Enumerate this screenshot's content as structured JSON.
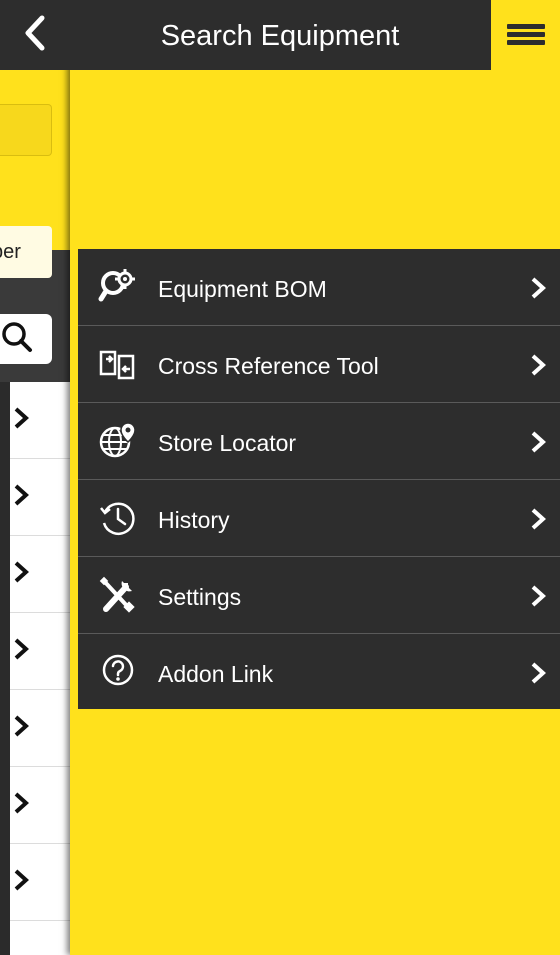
{
  "header": {
    "title": "Search Equipment",
    "back_icon": "chevron-left-icon",
    "menu_icon": "hamburger-menu-icon"
  },
  "background_page": {
    "input_partial_text": "ber",
    "search_icon": "magnifier-icon",
    "list_row_count": 7
  },
  "menu": {
    "items": [
      {
        "label": "Equipment BOM",
        "icon": "gear-search-icon"
      },
      {
        "label": "Cross Reference Tool",
        "icon": "cross-reference-icon"
      },
      {
        "label": "Store Locator",
        "icon": "globe-pin-icon"
      },
      {
        "label": "History",
        "icon": "history-clock-icon"
      },
      {
        "label": "Settings",
        "icon": "wrench-screwdriver-icon"
      },
      {
        "label": "Addon Link",
        "icon": "question-circle-icon"
      }
    ]
  },
  "colors": {
    "accent_yellow": "#ffe11c",
    "dark": "#2d2d2d",
    "divider": "#5a5a5a",
    "text_on_dark": "#ffffff"
  }
}
